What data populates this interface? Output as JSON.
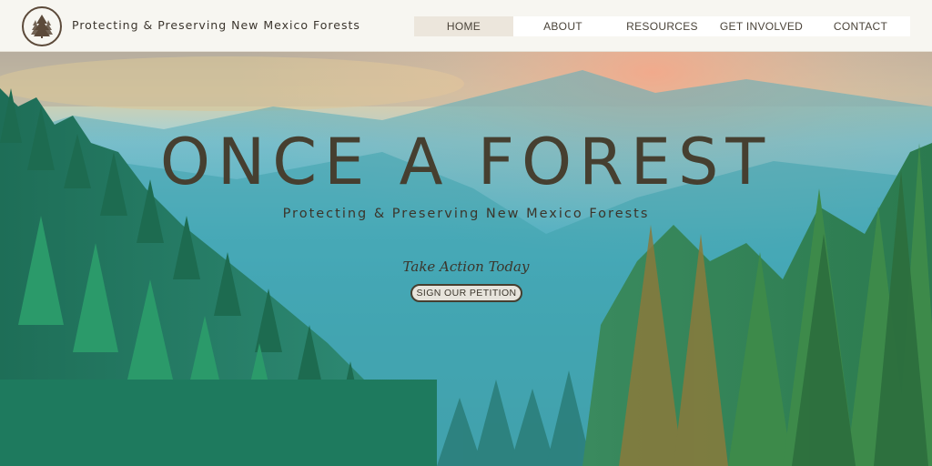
{
  "header": {
    "site_title": "Protecting & Preserving New Mexico Forests",
    "logo_icon": "tree-logo-icon"
  },
  "nav": {
    "items": [
      {
        "label": "HOME",
        "active": true
      },
      {
        "label": "ABOUT",
        "active": false
      },
      {
        "label": "RESOURCES",
        "active": false
      },
      {
        "label": "GET INVOLVED",
        "active": false
      },
      {
        "label": "CONTACT",
        "active": false
      }
    ]
  },
  "hero": {
    "title": "ONCE A FOREST",
    "subtitle": "Protecting & Preserving New Mexico Forests",
    "cta_label": "Take Action Today",
    "button_label": "SIGN OUR PETITION"
  },
  "colors": {
    "header_bg": "#f7f6f1",
    "nav_active_bg": "#ece6dc",
    "text_dark": "#463f30",
    "sky_teal": "#4cb8cf",
    "forest_green": "#2e7f5a"
  }
}
